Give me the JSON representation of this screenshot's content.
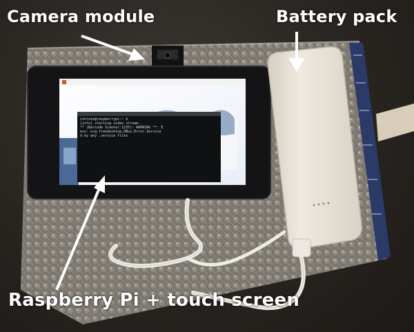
{
  "captions": {
    "camera_module": "Camera module",
    "battery_pack": "Battery pack",
    "raspberry_pi": "Raspberry Pi + touch screen"
  },
  "terminal": {
    "lines": [
      "ishrate@raspberrypi:~ $",
      "[info] starting video stream..",
      "",
      "** (Barcode Scanner:1235): WARNING **: E",
      "ess: org.freedesktop.DBus.Error.Service",
      "d by any .service files"
    ]
  },
  "colors": {
    "caption": "#ffffff",
    "arrow": "#ffffff",
    "screen_bezel": "#141416",
    "battery": "#e8e1d6",
    "bubble_wrap": "#8a857c",
    "tape": "#2b3a66",
    "cable": "#efece6"
  }
}
